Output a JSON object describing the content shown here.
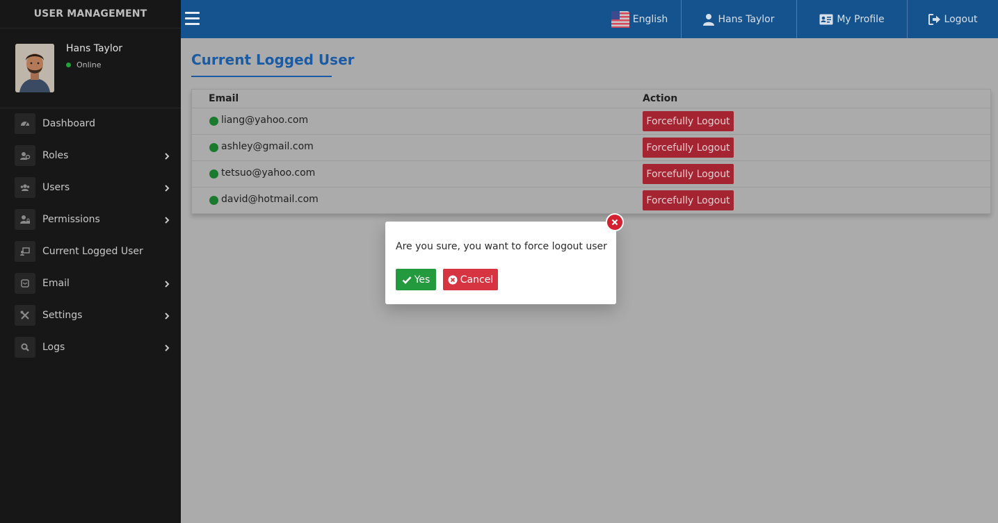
{
  "sidebar": {
    "brand": "USER MANAGEMENT",
    "user": {
      "name": "Hans Taylor",
      "status": "Online"
    },
    "items": [
      {
        "label": "Dashboard",
        "icon": "dashboard-icon",
        "has_children": false
      },
      {
        "label": "Roles",
        "icon": "roles-icon",
        "has_children": true
      },
      {
        "label": "Users",
        "icon": "users-icon",
        "has_children": true
      },
      {
        "label": "Permissions",
        "icon": "permissions-icon",
        "has_children": true
      },
      {
        "label": "Current Logged User",
        "icon": "logged-user-icon",
        "has_children": false
      },
      {
        "label": "Email",
        "icon": "email-icon",
        "has_children": true
      },
      {
        "label": "Settings",
        "icon": "settings-icon",
        "has_children": true
      },
      {
        "label": "Logs",
        "icon": "search-icon",
        "has_children": true
      }
    ]
  },
  "topbar": {
    "language": "English",
    "user": "Hans Taylor",
    "profile": "My Profile",
    "logout": "Logout"
  },
  "page": {
    "title": "Current Logged User",
    "table": {
      "headers": {
        "email": "Email",
        "action": "Action"
      },
      "rows": [
        {
          "email": "liang@yahoo.com",
          "action": "Forcefully Logout"
        },
        {
          "email": "ashley@gmail.com",
          "action": "Forcefully Logout"
        },
        {
          "email": "tetsuo@yahoo.com",
          "action": "Forcefully Logout"
        },
        {
          "email": "david@hotmail.com",
          "action": "Forcefully Logout"
        }
      ]
    }
  },
  "modal": {
    "message": "Are you sure, you want to force logout user",
    "yes_label": "Yes",
    "cancel_label": "Cancel"
  },
  "colors": {
    "sidebar_bg": "#171717",
    "topbar_bg": "#15538f",
    "title": "#1a5ba3",
    "danger": "#a52431",
    "success": "#239a3d",
    "online": "#22a33a"
  }
}
